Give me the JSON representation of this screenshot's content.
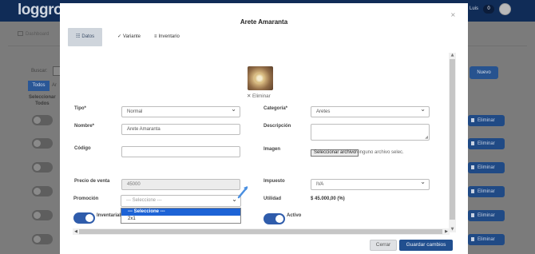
{
  "app": {
    "logo": "loggro",
    "user_name": "Luis",
    "notification_count": "0",
    "nav_item": "Dashboard",
    "search_label": "Buscar:",
    "filter_todos": "Todos",
    "filter_other": "Ar",
    "select_all": "Seleccionar\nTodos",
    "new_button": "Nuevo",
    "delete_label": "Eliminar",
    "delete_rows": 6
  },
  "modal": {
    "title": "Arete Amaranta",
    "close_icon": "×",
    "tabs": [
      {
        "icon": "☷",
        "label": "Datos",
        "active": true
      },
      {
        "icon": "✓",
        "label": "Variante",
        "active": false
      },
      {
        "icon": "≡",
        "label": "Inventario",
        "active": false
      }
    ],
    "image_delete": "✕ Eliminar",
    "fields": {
      "tipo": {
        "label": "Tipo*",
        "value": "Normal"
      },
      "categoria": {
        "label": "Categoría*",
        "value": "Aretes"
      },
      "nombre": {
        "label": "Nombre*",
        "value": "Arete Amaranta"
      },
      "descripcion": {
        "label": "Descripción",
        "value": ""
      },
      "codigo": {
        "label": "Código",
        "value": ""
      },
      "imagen": {
        "label": "Imagen",
        "button": "Seleccionar archivo",
        "status": "Ninguno archivo selec."
      },
      "precio": {
        "label": "Precio de venta",
        "value": "45000"
      },
      "impuesto": {
        "label": "Impuesto",
        "value": "IVA"
      },
      "utilidad": {
        "label": "Utilidad",
        "value": "$ 45.000,00 (%)"
      },
      "promocion": {
        "label": "Promoción",
        "value": "--- Seleccione ---",
        "options": [
          "--- Seleccione ---",
          "2x1"
        ],
        "highlighted_option": "--- Seleccione ---"
      },
      "inventariable": {
        "label": "Inventariable",
        "checked": true
      },
      "activo": {
        "label": "Activo",
        "checked": true
      }
    },
    "buttons": {
      "cancel": "Cerrar",
      "save": "Guardar cambios"
    }
  },
  "colors": {
    "topbar": "#102c57",
    "primary": "#214f8f",
    "dropdown_selected": "#1d63d6",
    "active_tab": "#cfd5dc"
  }
}
